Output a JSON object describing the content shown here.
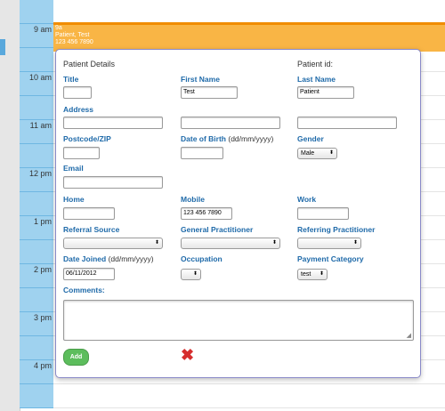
{
  "calendar": {
    "hours": [
      "9 am",
      "10 am",
      "11 am",
      "12 pm",
      "1 pm",
      "2 pm",
      "3 pm",
      "4 pm"
    ]
  },
  "appointment": {
    "line1": "9a",
    "line2": "Patient, Test",
    "line3": "123 456 7890"
  },
  "dialog": {
    "title": "Patient Details",
    "patient_id_label": "Patient id:",
    "title_label": "Title",
    "first_name_label": "First Name",
    "first_name_value": "Test",
    "last_name_label": "Last Name",
    "last_name_value": "Patient",
    "address_label": "Address",
    "postcode_label": "Postcode/ZIP",
    "dob_label": "Date of Birth",
    "dob_hint": "(dd/mm/yyyy)",
    "gender_label": "Gender",
    "gender_value": "Male",
    "email_label": "Email",
    "home_label": "Home",
    "mobile_label": "Mobile",
    "mobile_value": "123 456 7890",
    "work_label": "Work",
    "referral_source_label": "Referral Source",
    "gp_label": "General Practitioner",
    "referring_practitioner_label": "Referring Practitioner",
    "date_joined_label": "Date Joined",
    "date_joined_hint": "(dd/mm/yyyy)",
    "date_joined_value": "06/11/2012",
    "occupation_label": "Occupation",
    "payment_category_label": "Payment Category",
    "payment_category_value": "test",
    "comments_label": "Comments:",
    "add_label": "Add",
    "close_icon": "✖"
  }
}
